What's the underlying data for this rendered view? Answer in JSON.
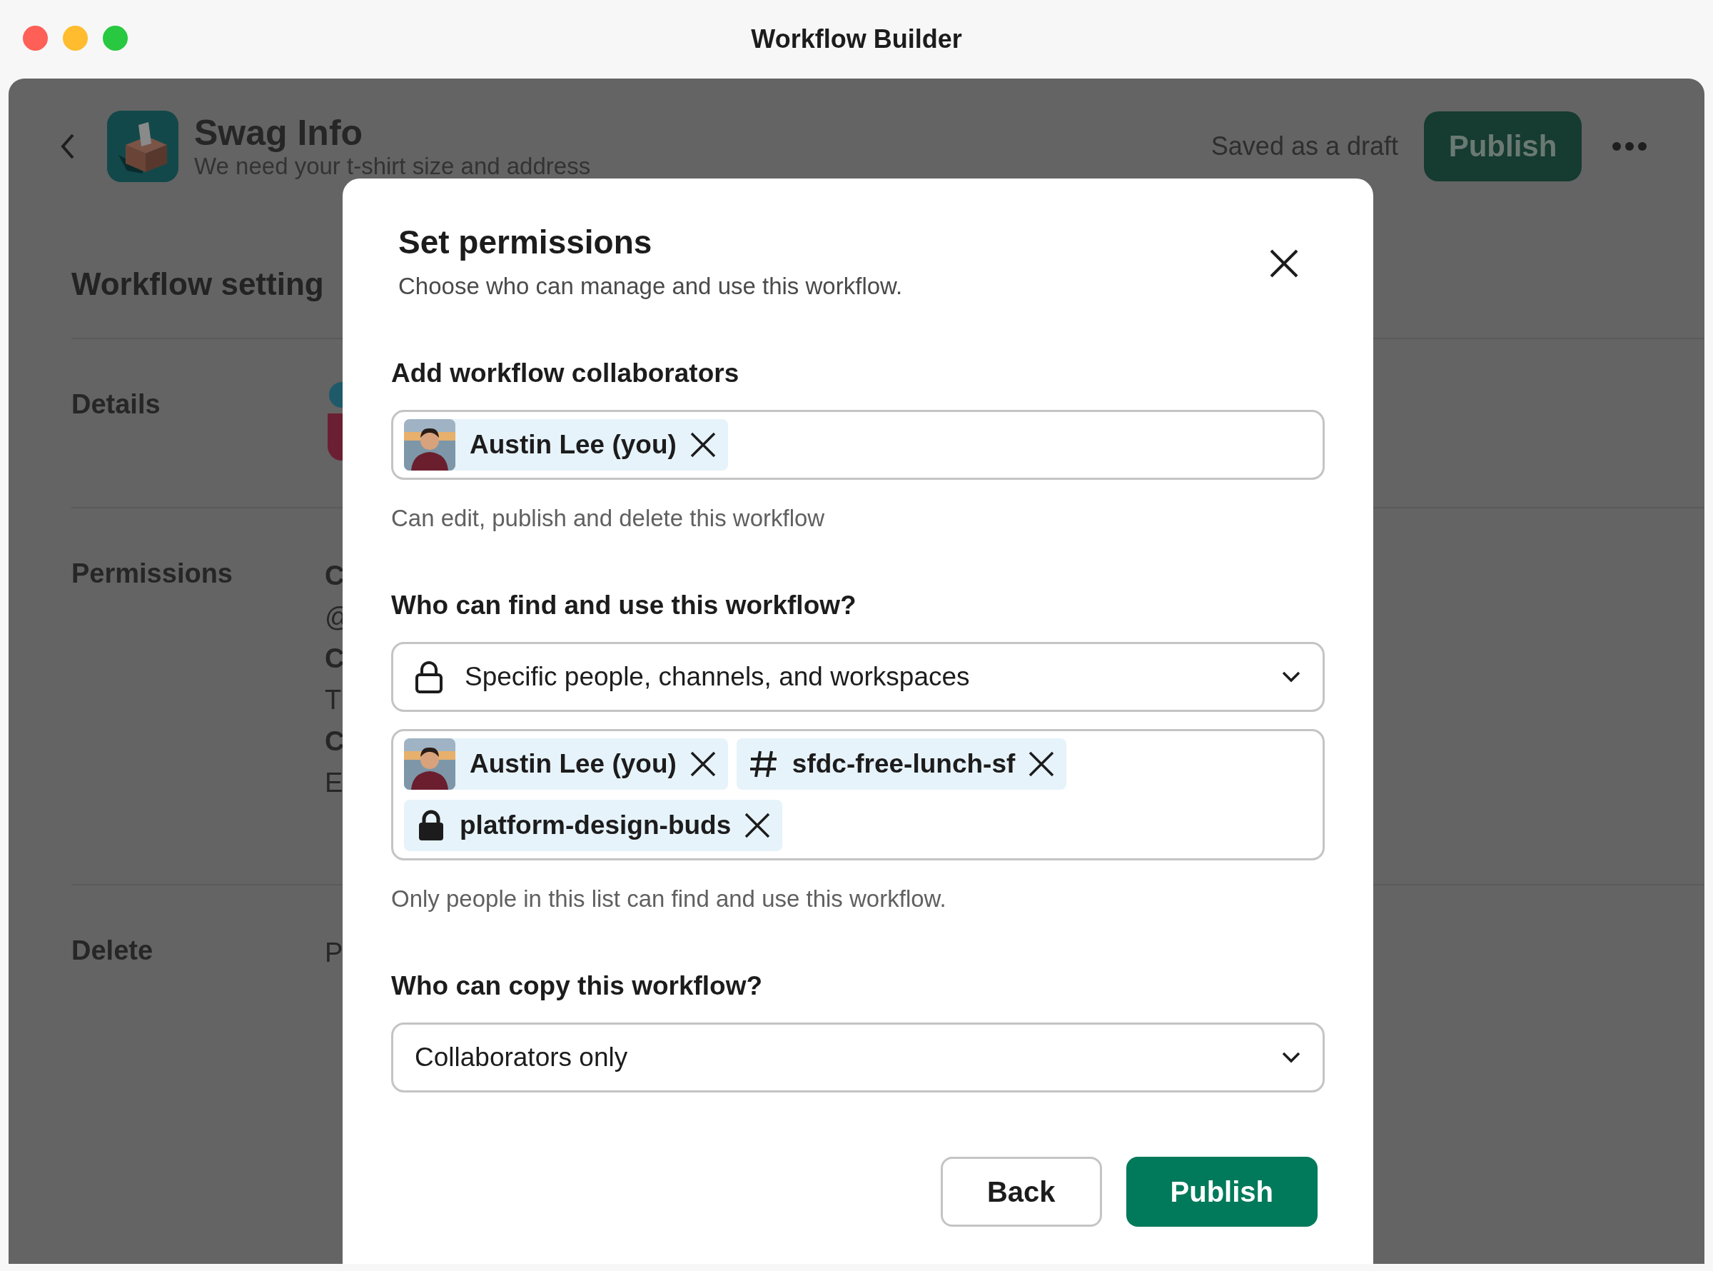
{
  "window": {
    "title": "Workflow Builder"
  },
  "header": {
    "title": "Swag Info",
    "subtitle": "We need your t-shirt size and address",
    "status": "Saved as a draft",
    "publish_button": "Publish"
  },
  "settings": {
    "title": "Workflow setting",
    "sections": [
      {
        "label": "Details",
        "kind": "icon"
      },
      {
        "label": "Permissions",
        "kind": "text",
        "lines": [
          {
            "text": "C",
            "bold": true
          },
          {
            "text": "@",
            "bold": false
          },
          {
            "text": "C",
            "bold": true
          },
          {
            "text": "T",
            "bold": false
          },
          {
            "text": "C",
            "bold": true
          },
          {
            "text": "E",
            "bold": false
          }
        ]
      },
      {
        "label": "Delete",
        "kind": "text",
        "lines": [
          {
            "text": "P",
            "bold": false
          }
        ]
      }
    ]
  },
  "modal": {
    "title": "Set permissions",
    "subtitle": "Choose who can manage and use this workflow.",
    "collaborators": {
      "label": "Add workflow collaborators",
      "chips": [
        {
          "kind": "person",
          "label": "Austin Lee (you)"
        }
      ],
      "hint": "Can edit, publish and delete this workflow"
    },
    "access": {
      "label": "Who can find and use this workflow?",
      "select": {
        "value": "Specific people, channels, and workspaces",
        "kind": "restricted"
      },
      "chips": [
        {
          "kind": "person",
          "label": "Austin Lee (you)"
        },
        {
          "kind": "channel",
          "label": "sfdc-free-lunch-sf"
        },
        {
          "kind": "private",
          "label": "platform-design-buds"
        }
      ],
      "hint": "Only people in this list can find and use this workflow."
    },
    "copy": {
      "label": "Who can copy this workflow?",
      "select": {
        "value": "Collaborators only"
      }
    },
    "buttons": [
      {
        "label": "Back",
        "kind": "secondary"
      },
      {
        "label": "Publish",
        "kind": "primary"
      }
    ]
  }
}
